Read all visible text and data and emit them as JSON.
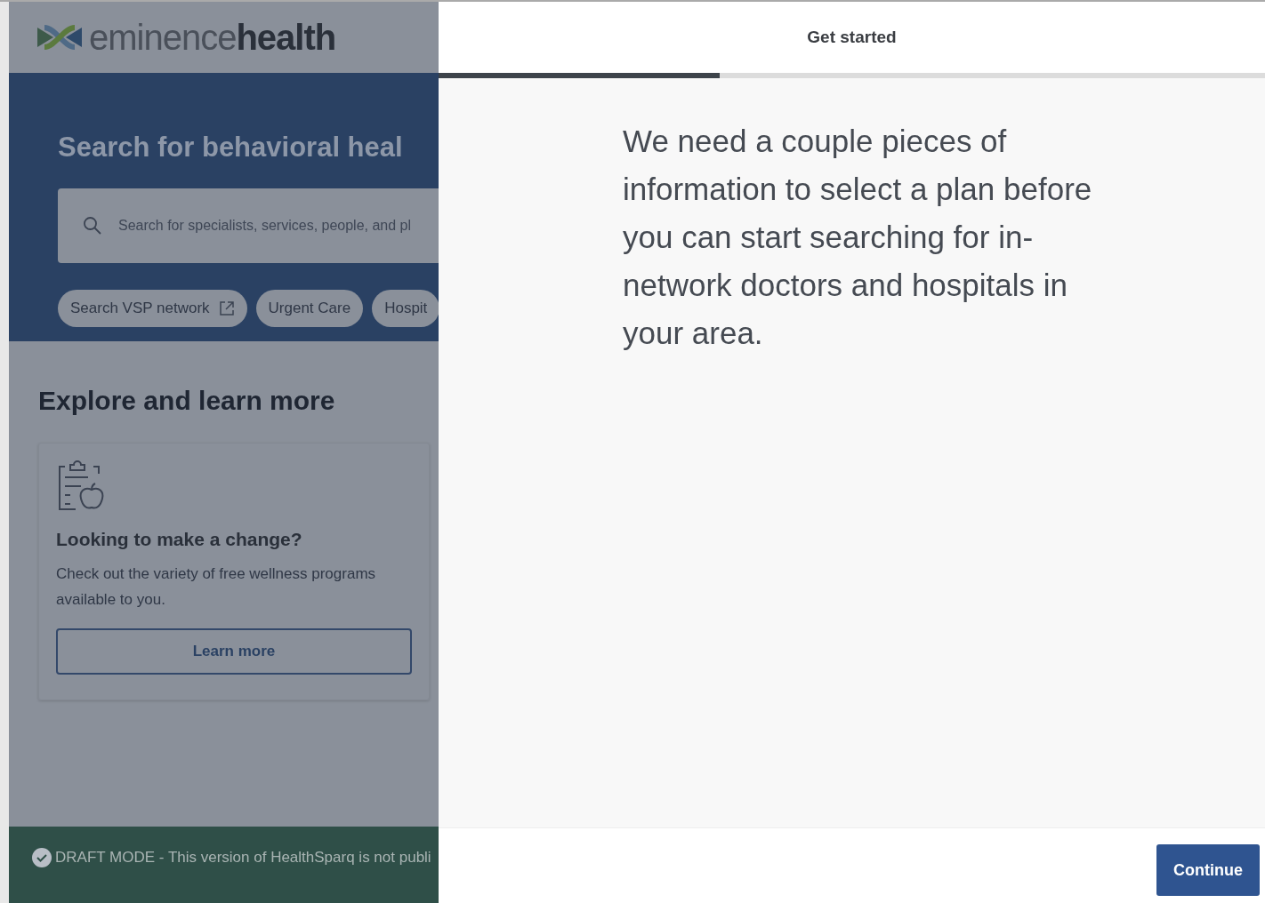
{
  "background_page": {
    "logo": "eminence**health**",
    "hero": {
      "title": "Search for behavioral heal",
      "search": {
        "placeholder": "Search for specialists, services, people, and pl"
      },
      "chips": [
        {
          "label": "Search VSP network",
          "external": true
        },
        {
          "label": "Urgent Care",
          "external": false
        },
        {
          "label": "Hospit",
          "external": false
        }
      ]
    },
    "section_title": "Explore and learn more",
    "card": {
      "title": "Looking to make a change?",
      "text": "Check out the variety of free wellness programs available to you.",
      "button": "Learn more"
    },
    "draft_banner": "DRAFT MODE - This version of HealthSparq is not publi"
  },
  "dialog": {
    "title": "Get started",
    "progress": {
      "level": 0.34
    },
    "message": "We need a couple pieces of information to select a plan before you can start searching for in-network doctors and hospitals in your area.",
    "button": "Continue"
  }
}
